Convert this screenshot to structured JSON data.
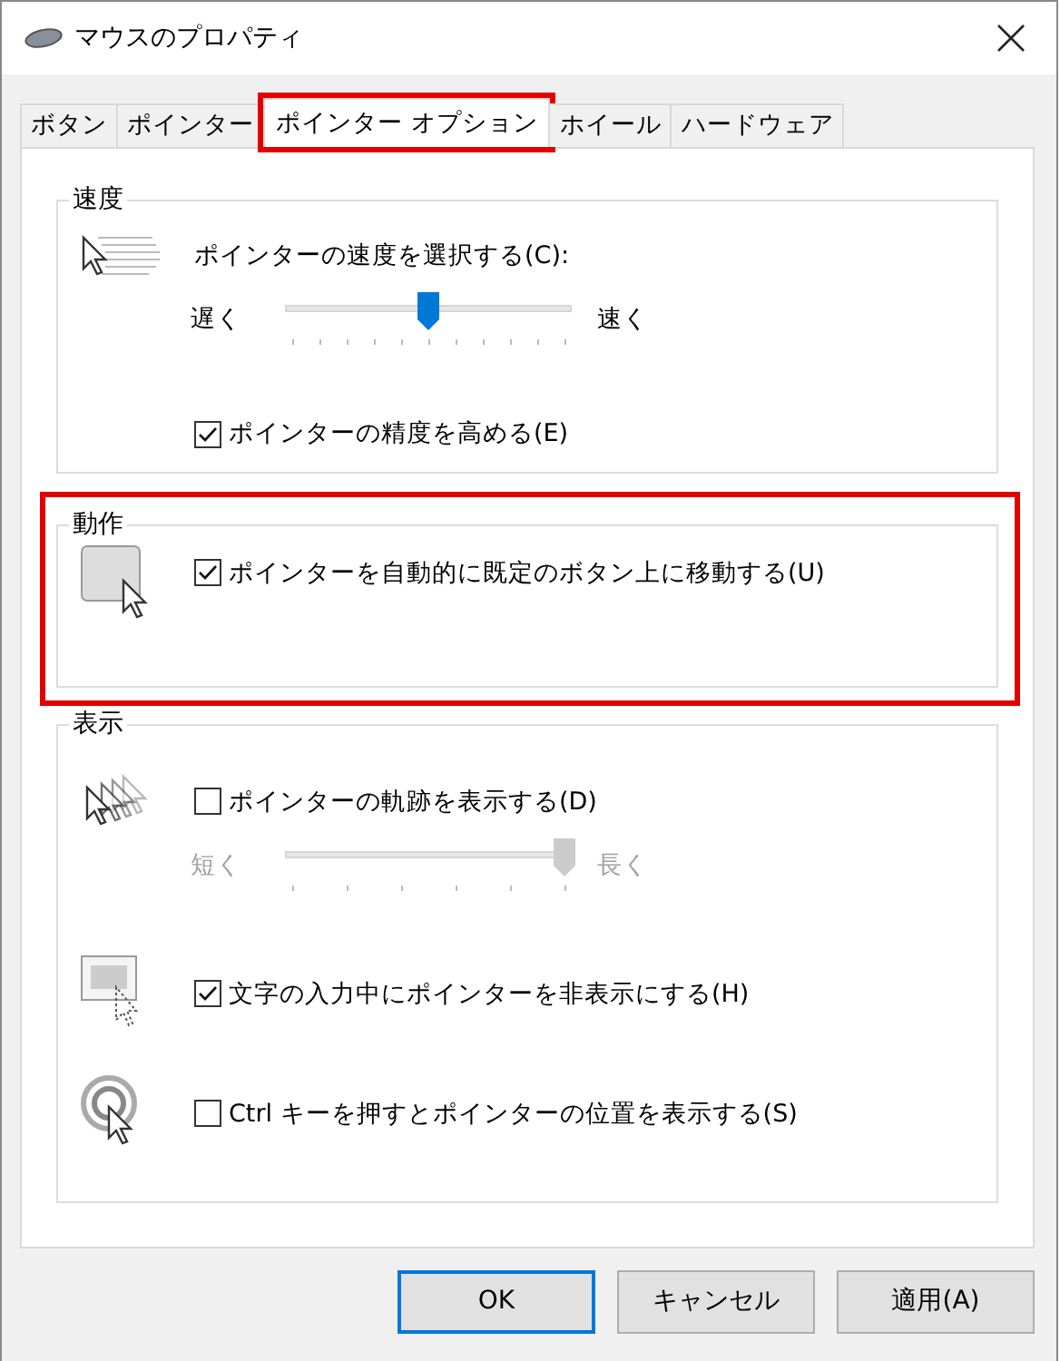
{
  "window": {
    "title": "マウスのプロパティ"
  },
  "tabs": [
    {
      "label": "ボタン",
      "selected": false,
      "highlighted": false
    },
    {
      "label": "ポインター",
      "selected": false,
      "highlighted": false
    },
    {
      "label": "ポインター オプション",
      "selected": true,
      "highlighted": true
    },
    {
      "label": "ホイール",
      "selected": false,
      "highlighted": false
    },
    {
      "label": "ハードウェア",
      "selected": false,
      "highlighted": false
    }
  ],
  "groups": [
    {
      "title": "速度",
      "highlighted": false,
      "sections": [
        {
          "rows": [
            {
              "kind": "label",
              "text": "ポインターの速度を選択する(C):"
            },
            {
              "kind": "slider",
              "left": "遅く",
              "right": "速く",
              "level": 0.5,
              "disabled": false
            },
            {
              "kind": "checkbox",
              "label": "ポインターの精度を高める(E)",
              "checked": true
            }
          ]
        }
      ]
    },
    {
      "title": "動作",
      "highlighted": true,
      "sections": [
        {
          "rows": [
            {
              "kind": "checkbox",
              "label": "ポインターを自動的に既定のボタン上に移動する(U)",
              "checked": true
            }
          ]
        }
      ]
    },
    {
      "title": "表示",
      "highlighted": false,
      "sections": [
        {
          "rows": [
            {
              "kind": "checkbox",
              "label": "ポインターの軌跡を表示する(D)",
              "checked": false
            },
            {
              "kind": "slider",
              "left": "短く",
              "right": "長く",
              "level": 1,
              "disabled": true
            }
          ]
        },
        {
          "rows": [
            {
              "kind": "checkbox",
              "label": "文字の入力中にポインターを非表示にする(H)",
              "checked": true
            }
          ]
        },
        {
          "rows": [
            {
              "kind": "checkbox",
              "label": "Ctrl キーを押すとポインターの位置を表示する(S)",
              "checked": false
            }
          ]
        }
      ]
    }
  ],
  "buttons": [
    {
      "label": "OK",
      "default": true
    },
    {
      "label": "キャンセル",
      "default": false
    },
    {
      "label": "適用(A)",
      "default": false
    }
  ]
}
